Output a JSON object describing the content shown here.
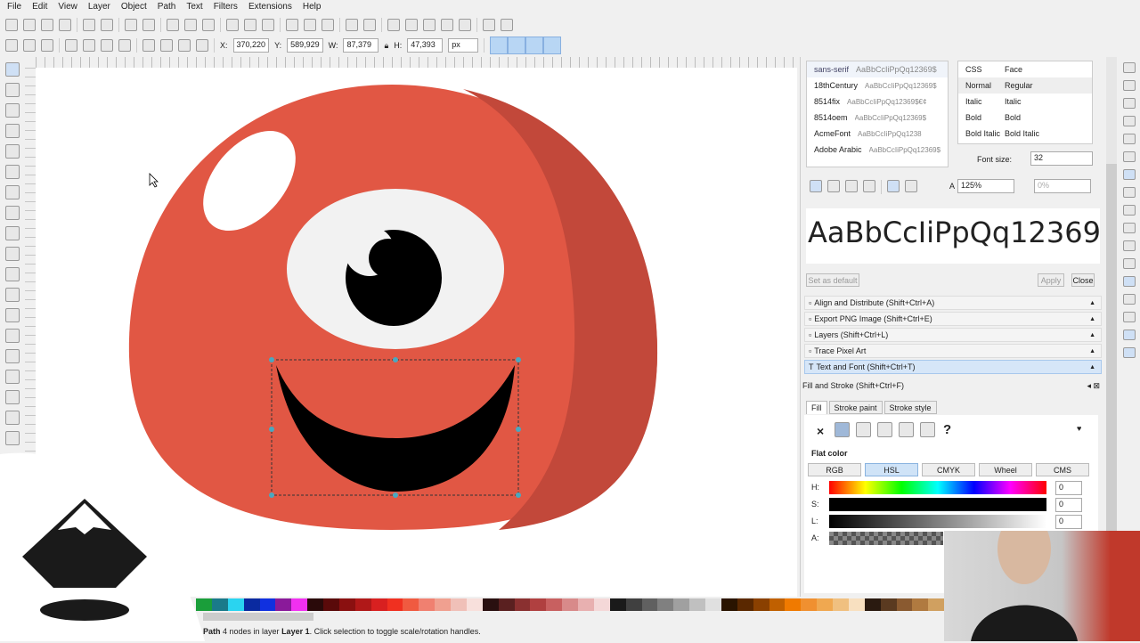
{
  "menu": [
    "File",
    "Edit",
    "View",
    "Layer",
    "Object",
    "Path",
    "Text",
    "Filters",
    "Extensions",
    "Help"
  ],
  "toolbar2": {
    "x_label": "X:",
    "x": "370,220",
    "y_label": "Y:",
    "y": "589,929",
    "w_label": "W:",
    "w": "87,379",
    "h_label": "H:",
    "h": "47,393",
    "unit": "px"
  },
  "fonts": {
    "selected": "sans-serif",
    "selected_sample": "AaBbCcIiPpQq12369$",
    "list": [
      {
        "name": "18thCentury",
        "sample": "AaBbCcIiPpQq12369$"
      },
      {
        "name": "8514fix",
        "sample": "AaBbCcIiPpQq12369$€¢"
      },
      {
        "name": "8514oem",
        "sample": "AaBbCcIiPpQq12369$"
      },
      {
        "name": "AcmeFont",
        "sample": "AaBbCcIiPpQq1238"
      },
      {
        "name": "Adobe Arabic",
        "sample": "AaBbCcIiPpQq12369$"
      }
    ]
  },
  "faces": {
    "header": [
      "CSS",
      "Face"
    ],
    "rows": [
      [
        "Normal",
        "Regular"
      ],
      [
        "Italic",
        "Italic"
      ],
      [
        "Bold",
        "Bold"
      ],
      [
        "Bold Italic",
        "Bold Italic"
      ]
    ]
  },
  "font_size": {
    "label": "Font size:",
    "value": "32"
  },
  "line_spacing": "125%",
  "letter_spacing": "0%",
  "preview": "AaBbCcIiPpQq12369...",
  "buttons": {
    "set_default": "Set as default",
    "apply": "Apply",
    "close": "Close"
  },
  "dock_sections": [
    "Align and Distribute (Shift+Ctrl+A)",
    "Export PNG Image (Shift+Ctrl+E)",
    "Layers (Shift+Ctrl+L)",
    "Trace Pixel Art",
    "Text and Font (Shift+Ctrl+T)"
  ],
  "fill_stroke": {
    "title": "Fill and Stroke (Shift+Ctrl+F)",
    "tabs": [
      "Fill",
      "Stroke paint",
      "Stroke style"
    ],
    "flat_color": "Flat color",
    "modes": [
      "RGB",
      "HSL",
      "CMYK",
      "Wheel",
      "CMS"
    ],
    "sliders": [
      {
        "label": "H:",
        "value": "0"
      },
      {
        "label": "S:",
        "value": "0"
      },
      {
        "label": "L:",
        "value": "0"
      },
      {
        "label": "A:",
        "value": ""
      }
    ],
    "unknown": "?",
    "none": "×"
  },
  "palette": [
    "#1a9e3a",
    "#1a7a8a",
    "#2ad4f0",
    "#0a2aa0",
    "#1030e0",
    "#8a1a9a",
    "#f030f0",
    "#2a0a0a",
    "#5a0a0a",
    "#8a1010",
    "#b01818",
    "#d82020",
    "#f03020",
    "#f05a40",
    "#f08070",
    "#f0a090",
    "#f0c0b8",
    "#f8e0dc",
    "#2a1010",
    "#5a2020",
    "#8a3030",
    "#b04040",
    "#c86060",
    "#d88a8a",
    "#e8b0b0",
    "#f4d8d8",
    "#1a1a1a",
    "#404040",
    "#606060",
    "#808080",
    "#a0a0a0",
    "#c0c0c0",
    "#e0e0e0",
    "#2a1400",
    "#5a2800",
    "#8a4000",
    "#c06000",
    "#f07a00",
    "#f09030",
    "#f0a850",
    "#f0c080",
    "#f8e0c0",
    "#2a1a10",
    "#5a3a20",
    "#8a5a30",
    "#b07a40",
    "#d0a060"
  ],
  "status": {
    "object": "Path",
    "nodes": " 4 nodes in layer ",
    "layer": "Layer 1",
    "hint": ". Click selection to toggle scale/rotation handles."
  },
  "colors": {
    "body": "#e15744",
    "shadow": "#c2483a",
    "accent": "#b8d6f4"
  }
}
